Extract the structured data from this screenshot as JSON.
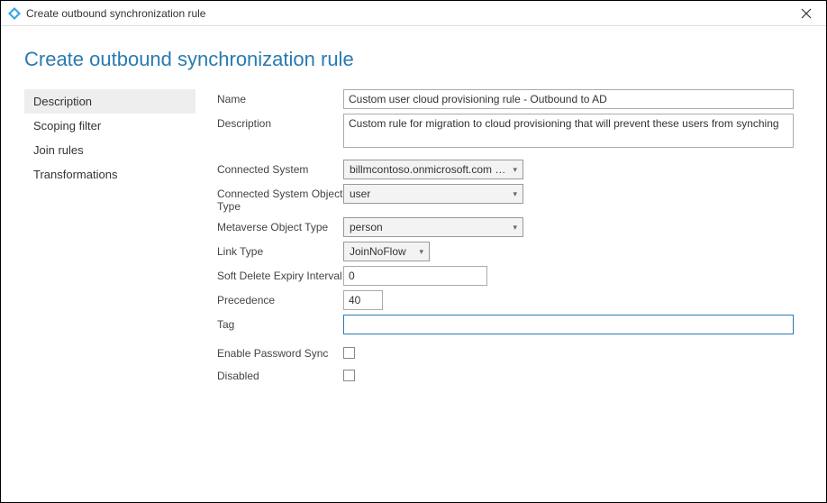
{
  "window": {
    "title": "Create outbound synchronization rule"
  },
  "heading": "Create outbound synchronization rule",
  "sidebar": {
    "items": [
      {
        "label": "Description",
        "active": true
      },
      {
        "label": "Scoping filter",
        "active": false
      },
      {
        "label": "Join rules",
        "active": false
      },
      {
        "label": "Transformations",
        "active": false
      }
    ]
  },
  "form": {
    "name_label": "Name",
    "name_value": "Custom user cloud provisioning rule - Outbound to AD",
    "description_label": "Description",
    "description_value": "Custom rule for migration to cloud provisioning that will prevent these users from synching",
    "connected_system_label": "Connected System",
    "connected_system_value": "billmcontoso.onmicrosoft.com - ...",
    "connected_system_object_type_label": "Connected System Object Type",
    "connected_system_object_type_value": "user",
    "metaverse_object_type_label": "Metaverse Object Type",
    "metaverse_object_type_value": "person",
    "link_type_label": "Link Type",
    "link_type_value": "JoinNoFlow",
    "soft_delete_label": "Soft Delete Expiry Interval",
    "soft_delete_value": "0",
    "precedence_label": "Precedence",
    "precedence_value": "40",
    "tag_label": "Tag",
    "tag_value": "",
    "enable_password_sync_label": "Enable Password Sync",
    "disabled_label": "Disabled"
  }
}
